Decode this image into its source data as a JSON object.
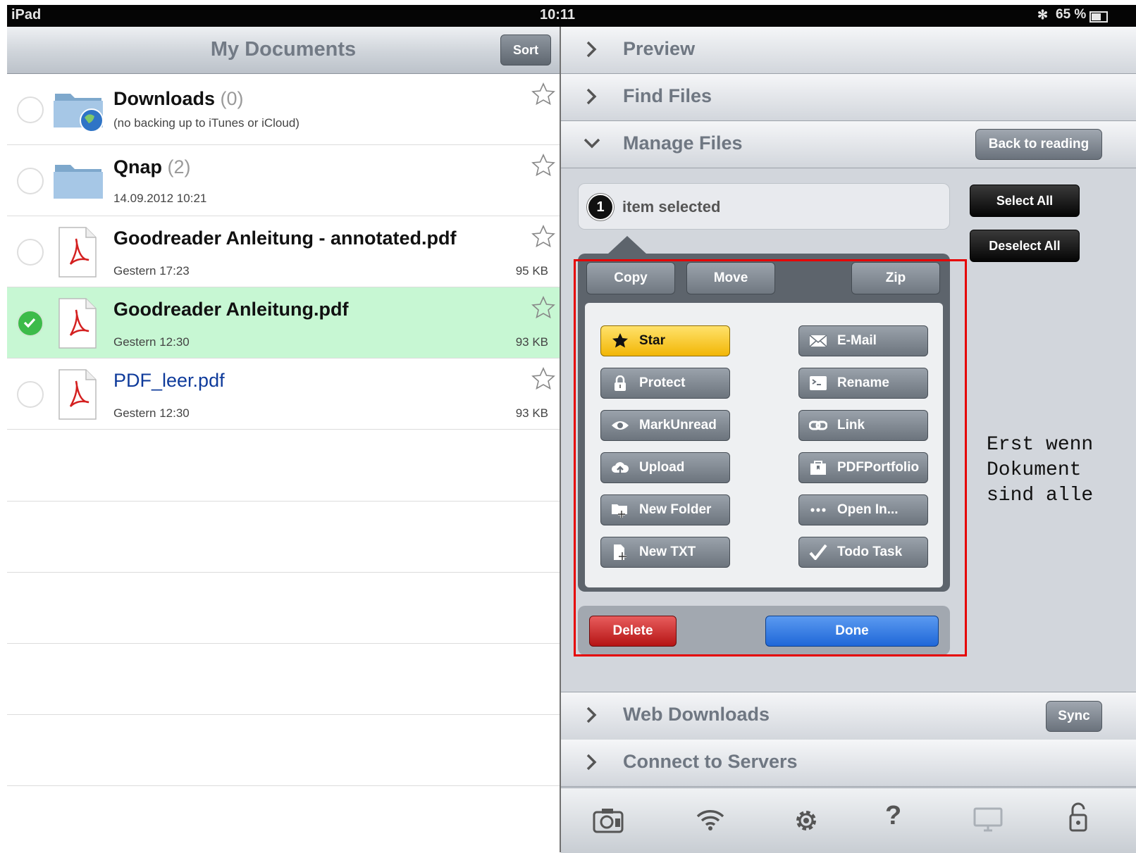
{
  "status": {
    "carrier": "iPad",
    "time": "10:11",
    "battery": "65 %"
  },
  "left": {
    "title": "My Documents",
    "sort_label": "Sort",
    "files": [
      {
        "name": "Downloads",
        "count": "(0)",
        "meta": "(no backing up to iTunes or iCloud)",
        "size": "",
        "type": "folder-web",
        "selected": false
      },
      {
        "name": "Qnap",
        "count": "(2)",
        "meta": "14.09.2012 10:21",
        "size": "",
        "type": "folder",
        "selected": false
      },
      {
        "name": "Goodreader Anleitung - annotated.pdf",
        "count": "",
        "meta": "Gestern 17:23",
        "size": "95 KB",
        "type": "pdf",
        "selected": false
      },
      {
        "name": "Goodreader Anleitung.pdf",
        "count": "",
        "meta": "Gestern 12:30",
        "size": "93 KB",
        "type": "pdf",
        "selected": true
      },
      {
        "name": "PDF_leer.pdf",
        "count": "",
        "meta": "Gestern 12:30",
        "size": "93 KB",
        "type": "pdf",
        "selected": false
      }
    ]
  },
  "right": {
    "sections": {
      "preview": "Preview",
      "find": "Find Files",
      "manage": "Manage Files",
      "web": "Web Downloads",
      "connect": "Connect to Servers"
    },
    "back_to_reading": "Back to reading",
    "sync": "Sync",
    "select_all": "Select All",
    "deselect_all": "Deselect All",
    "selected_count": "1",
    "selected_text": "item selected",
    "tabs": {
      "copy": "Copy",
      "move": "Move",
      "zip": "Zip"
    },
    "actions": {
      "star": "Star",
      "email": "E-Mail",
      "protect": "Protect",
      "rename": "Rename",
      "markunread": "MarkUnread",
      "link": "Link",
      "upload": "Upload",
      "pdfportfolio": "PDFPortfolio",
      "newfolder": "New Folder",
      "openin": "Open In...",
      "newtxt": "New TXT",
      "todotask": "Todo Task"
    },
    "delete": "Delete",
    "done": "Done",
    "note": "Erst wenn\nDokument\nsind alle",
    "toolbar_icons": [
      "camera-icon",
      "wifi-icon",
      "gear-icon",
      "help-icon",
      "monitor-icon",
      "lock-icon"
    ]
  }
}
